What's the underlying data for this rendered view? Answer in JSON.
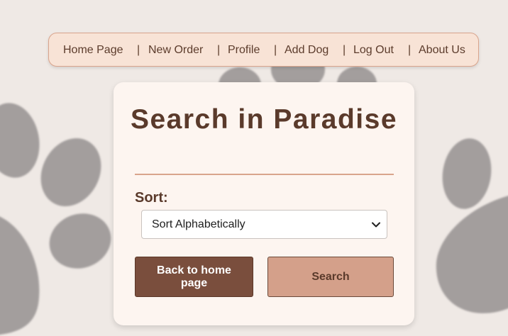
{
  "nav": {
    "items": [
      {
        "label": "Home Page"
      },
      {
        "label": "New Order"
      },
      {
        "label": "Profile"
      },
      {
        "label": "Add Dog"
      },
      {
        "label": "Log Out"
      },
      {
        "label": "About Us"
      }
    ],
    "separator": "|"
  },
  "card": {
    "title": "Search in Paradise",
    "sort_label": "Sort:",
    "sort_select": {
      "selected": "Sort Alphabetically",
      "icon": "chevron-down-icon"
    },
    "back_button": "Back to home page",
    "search_button": "Search"
  },
  "colors": {
    "background": "#efe9e5",
    "paw_print": "#a39e9d",
    "nav_bg": "#f8e3d6",
    "nav_border": "#d9a48c",
    "card_bg": "#fdf5f0",
    "title_text": "#5a3a2b",
    "back_button_bg": "#7a4e3d",
    "search_button_bg": "#d4a08a"
  }
}
